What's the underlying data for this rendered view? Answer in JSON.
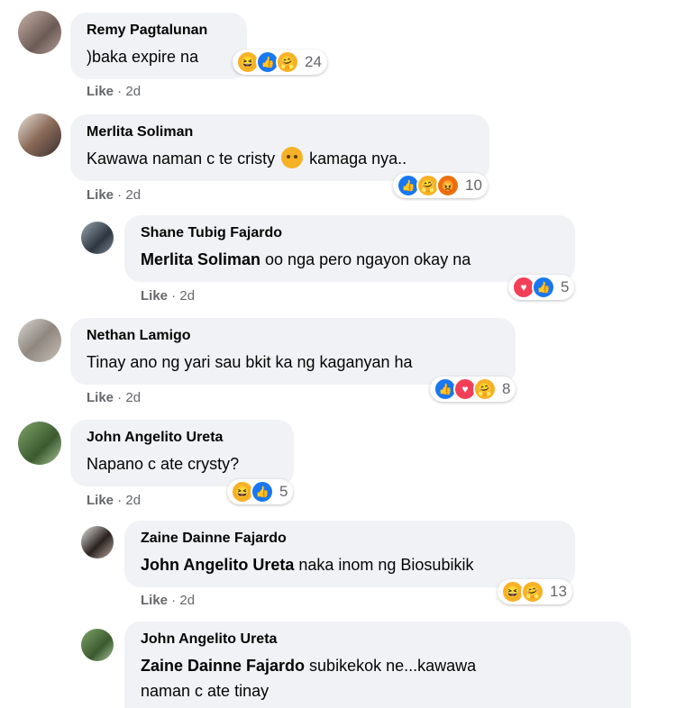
{
  "comments": [
    {
      "name": "Remy Pagtalunan",
      "text": ")baka expire na",
      "like": "Like",
      "sep": " · ",
      "time": "2d",
      "count": "24"
    },
    {
      "name": "Merlita Soliman",
      "text_before": "Kawawa naman c te cristy ",
      "text_after": " kamaga nya..",
      "like": "Like",
      "sep": " · ",
      "time": "2d",
      "count": "10"
    },
    {
      "name": "Shane Tubig Fajardo",
      "tag": "Merlita Soliman",
      "text": " oo nga pero ngayon okay na",
      "like": "Like",
      "sep": " · ",
      "time": "2d",
      "count": "5"
    },
    {
      "name": "Nethan Lamigo",
      "text": "Tinay ano ng yari sau bkit ka ng kaganyan ha",
      "like": "Like",
      "sep": " · ",
      "time": "2d",
      "count": "8"
    },
    {
      "name": "John Angelito Ureta",
      "text": "Napano c ate crysty?",
      "like": "Like",
      "sep": " · ",
      "time": "2d",
      "count": "5"
    },
    {
      "name": "Zaine Dainne Fajardo",
      "tag": "John Angelito Ureta",
      "text": " naka inom ng Biosubikik",
      "like": "Like",
      "sep": " · ",
      "time": "2d",
      "count": "13"
    },
    {
      "name": "John Angelito Ureta",
      "tag": "Zaine Dainne Fajardo",
      "text_line1": " subikekok ne...kawawa",
      "text_line2": "naman c ate tinay"
    }
  ],
  "icons": [
    "haha-icon",
    "like-icon",
    "care-icon",
    "sad-icon",
    "angry-icon",
    "love-icon"
  ],
  "colors": {
    "bubble": "#f0f2f5",
    "like_blue": "#1877f2",
    "love_red": "#f33e58",
    "emoji_yellow": "#f7b125",
    "meta_gray": "#65676b"
  }
}
